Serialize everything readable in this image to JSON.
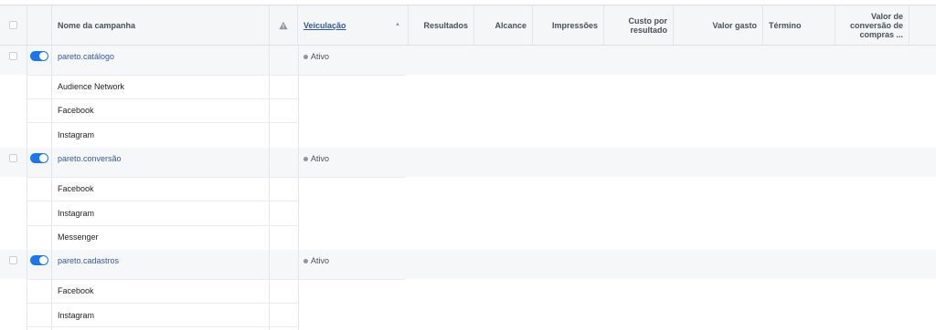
{
  "header": {
    "campaign_name": "Nome da campanha",
    "delivery": "Veiculação",
    "results": "Resultados",
    "reach": "Alcance",
    "impressions": "Impressões",
    "cost_per_result": [
      "Custo por",
      "resultado"
    ],
    "amount_spent": "Valor gasto",
    "end": "Término",
    "purchase_value": [
      "Valor de",
      "conversão de",
      "compras ..."
    ]
  },
  "campaigns": [
    {
      "name": "pareto.catálogo",
      "status": "Ativo",
      "placements": [
        "Audience Network",
        "Facebook",
        "Instagram"
      ]
    },
    {
      "name": "pareto.conversão",
      "status": "Ativo",
      "placements": [
        "Facebook",
        "Instagram",
        "Messenger"
      ]
    },
    {
      "name": "pareto.cadastros",
      "status": "Ativo",
      "placements": [
        "Facebook",
        "Instagram"
      ]
    }
  ],
  "colors": {
    "accent": "#1877f2",
    "link": "#365899",
    "header_bg": "#f5f6f7",
    "campaign_row_bg": "#f6f7f9"
  },
  "icons": {
    "warning": "warning-icon",
    "sort": "sort-ascending-icon"
  }
}
